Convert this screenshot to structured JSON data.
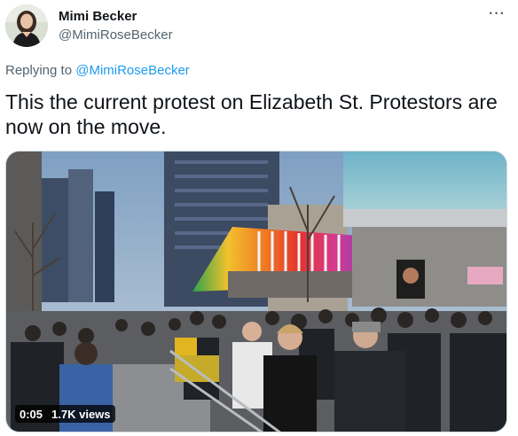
{
  "author": {
    "display_name": "Mimi Becker",
    "handle": "@MimiRoseBecker"
  },
  "more_menu": "···",
  "reply": {
    "prefix": "Replying to",
    "handle": "@MimiRoseBecker"
  },
  "tweet": {
    "text": "This the current protest on Elizabeth St. Protestors are now on the move."
  },
  "video": {
    "duration": "0:05",
    "views": "1.7K views"
  },
  "colors": {
    "link": "#1d9bf0",
    "secondary_text": "#536471",
    "primary_text": "#0f1419"
  }
}
